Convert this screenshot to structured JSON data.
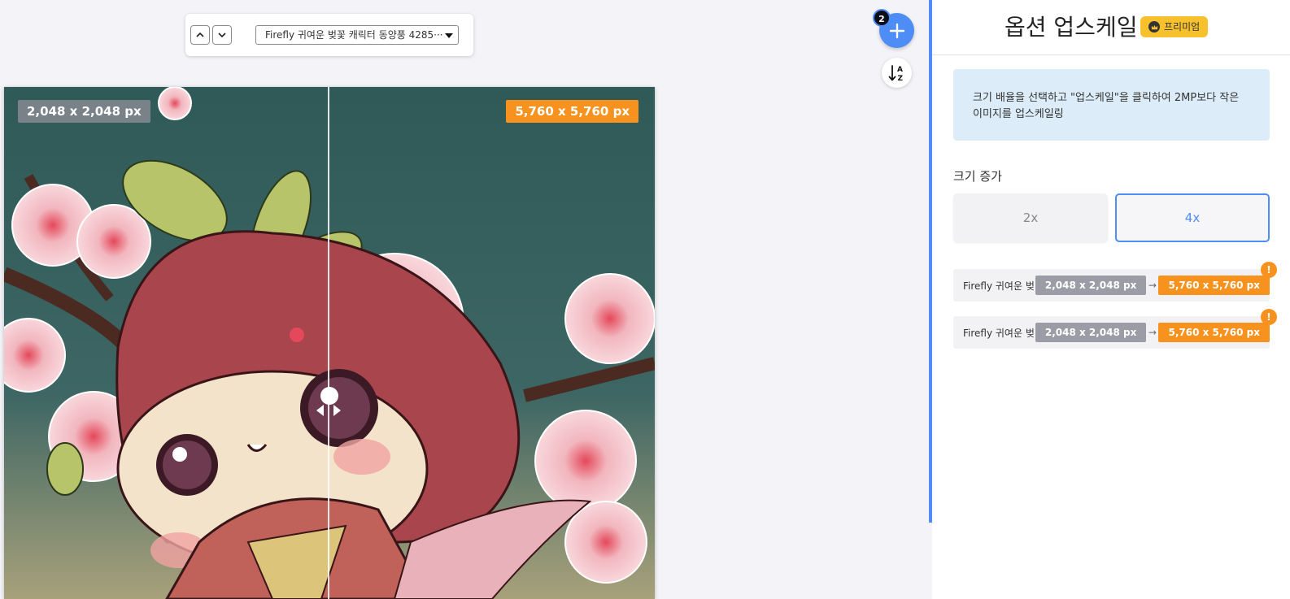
{
  "toolbar": {
    "file_select_value": "Firefly 귀여운 벚꽃 캐릭터 동양풍 4285···"
  },
  "fab": {
    "add_icon": "plus-icon",
    "file_count": "2",
    "sort_icon": "sort-alpha-down-icon"
  },
  "preview": {
    "before_size": "2,048 x 2,048 px",
    "after_size": "5,760 x 5,760 px",
    "compare_position": 0.5
  },
  "panel": {
    "title": "옵션 업스케일",
    "premium_label": "프리미엄",
    "info_text": "크기 배율을 선택하고 \"업스케일\"을 클릭하여 2MP보다 작은 이미지를 업스케일링",
    "scale_label": "크기 증가",
    "scale_options": [
      "2x",
      "4x"
    ],
    "selected_scale": "4x",
    "files": [
      {
        "name": "Firefly 귀여운 벚···",
        "from": "2,048 x 2,048 px",
        "to": "5,760 x 5,760 px",
        "warning": "!"
      },
      {
        "name": "Firefly 귀여운 벚···",
        "from": "2,048 x 2,048 px",
        "to": "5,760 x 5,760 px",
        "warning": "!"
      }
    ]
  },
  "colors": {
    "accent": "#4d8df5",
    "orange": "#f7921e",
    "premium": "#f7c12e",
    "info_bg": "#dcedf9"
  }
}
